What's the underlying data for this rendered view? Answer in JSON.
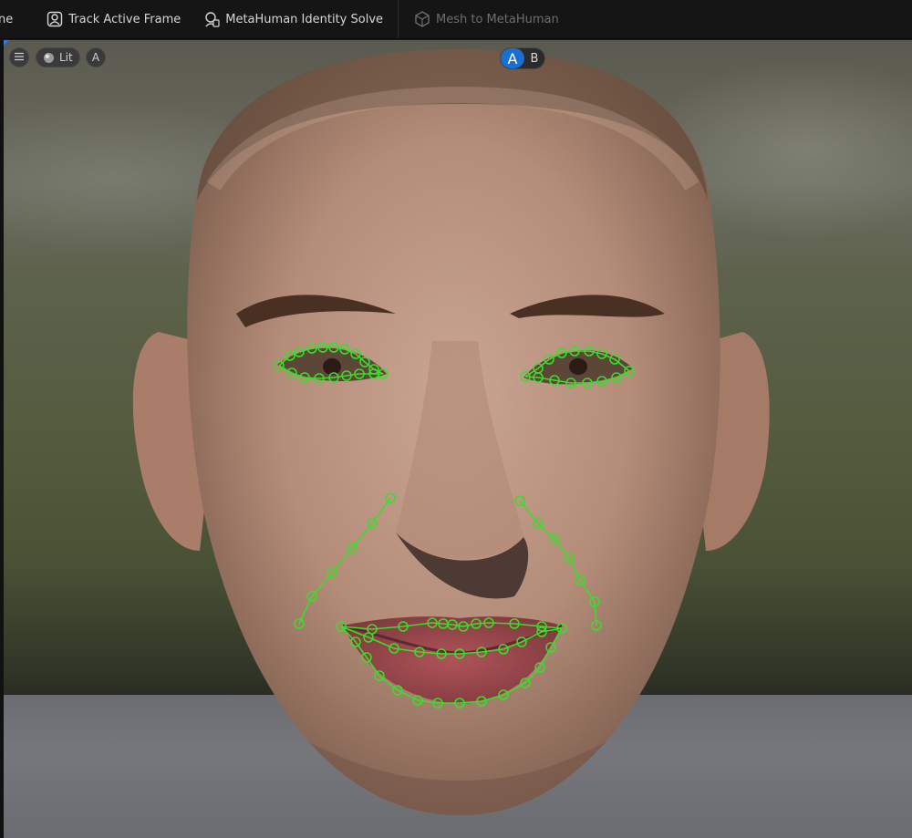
{
  "toolbar": {
    "partial_label": "ne",
    "track_label": "Track Active Frame",
    "solve_label": "MetaHuman Identity Solve",
    "mesh_label": "Mesh to MetaHuman",
    "icons": {
      "track": "track-frame-icon",
      "solve": "identity-solve-icon",
      "mesh": "mesh-to-metahuman-icon"
    }
  },
  "viewport": {
    "menu_icon": "hamburger-icon",
    "view_mode_label": "Lit",
    "view_mode_icon": "lit-sphere-icon",
    "camera_label": "A",
    "ab": {
      "a": "A",
      "b": "B",
      "active": "A"
    }
  },
  "colors": {
    "accent": "#1a6fd1",
    "tracker": "#3ddc2c",
    "toolbar_bg": "#151515"
  }
}
